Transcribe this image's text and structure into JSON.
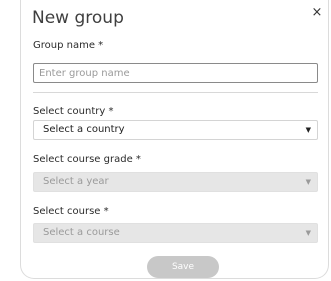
{
  "dialog": {
    "title": "New group",
    "close_glyph": "×"
  },
  "group_name": {
    "label": "Group name *",
    "value": "",
    "placeholder": "Enter group name"
  },
  "country": {
    "label": "Select country *",
    "selected": "Select a country",
    "enabled": true
  },
  "course_grade": {
    "label": "Select course grade *",
    "selected": "Select a year",
    "enabled": false
  },
  "course": {
    "label": "Select course *",
    "selected": "Select a course",
    "enabled": false
  },
  "caret_glyph": "▼",
  "save_label": "Save",
  "colors": {
    "save_button_bg": "#c8c8c8",
    "disabled_select_bg": "#e6e6e6",
    "input_border": "#8a8a8a"
  },
  "icons": {
    "close": "close-icon",
    "dropdown": "chevron-down-icon"
  }
}
